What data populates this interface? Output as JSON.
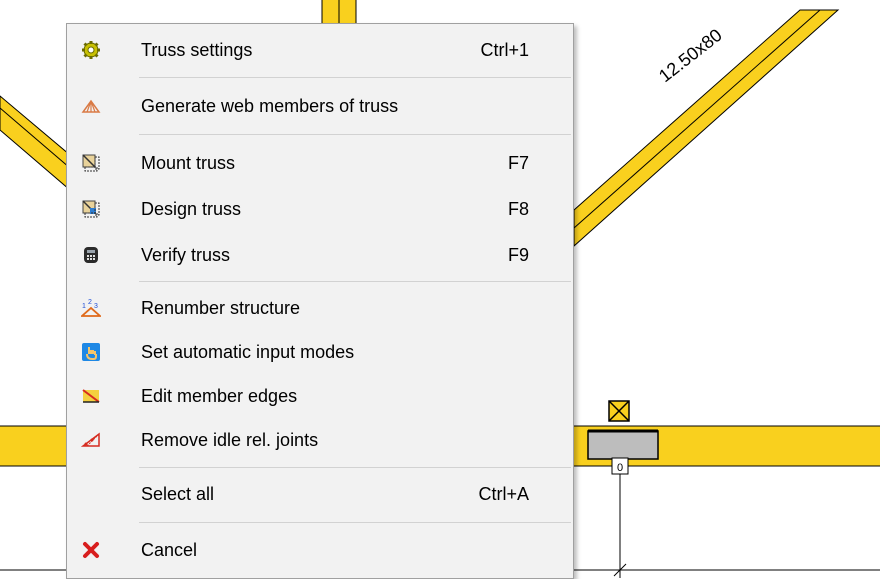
{
  "canvas": {
    "beam_label": "12.50x80",
    "support_label": "0",
    "beam_color": "#f9d01e"
  },
  "menu": {
    "items": [
      {
        "label": "Truss settings",
        "shortcut": "Ctrl+1",
        "icon": "gear-icon"
      },
      {
        "label": "Generate web members of truss",
        "shortcut": "",
        "icon": "truss-generate-icon"
      },
      {
        "label": "Mount truss",
        "shortcut": "F7",
        "icon": "mount-truss-icon"
      },
      {
        "label": "Design truss",
        "shortcut": "F8",
        "icon": "design-truss-icon"
      },
      {
        "label": "Verify truss",
        "shortcut": "F9",
        "icon": "calculator-icon"
      },
      {
        "label": "Renumber structure",
        "shortcut": "",
        "icon": "renumber-icon"
      },
      {
        "label": "Set automatic input modes",
        "shortcut": "",
        "icon": "hand-cursor-icon"
      },
      {
        "label": "Edit member edges",
        "shortcut": "",
        "icon": "edit-edges-icon"
      },
      {
        "label": "Remove idle rel. joints",
        "shortcut": "",
        "icon": "remove-joints-icon"
      },
      {
        "label": "Select all",
        "shortcut": "Ctrl+A",
        "icon": ""
      },
      {
        "label": "Cancel",
        "shortcut": "",
        "icon": "cancel-x-icon"
      }
    ]
  }
}
